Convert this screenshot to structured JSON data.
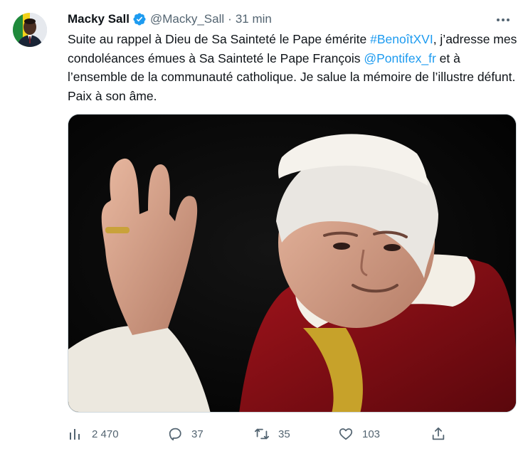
{
  "author": {
    "name": "Macky Sall",
    "handle": "@Macky_Sall",
    "separator": "·",
    "time": "31 min"
  },
  "tweet": {
    "part1": "Suite au rappel à Dieu de Sa Sainteté le Pape émérite ",
    "hashtag": "#BenoîtXVI",
    "part2": ", j’adresse mes condoléances émues à Sa Sainteté le Pape François ",
    "mention": "@Pontifex_fr",
    "part3": " et à l’ensemble de la communauté catholique. Je salue la mémoire de l’illustre défunt. Paix à son âme."
  },
  "actions": {
    "views": "2 470",
    "replies": "37",
    "retweets": "35",
    "likes": "103"
  },
  "colors": {
    "link": "#1d9bf0",
    "verified": "#1d9bf0",
    "muted": "#536471",
    "text": "#0f1419"
  },
  "icons": [
    "verified-badge-icon",
    "more-icon",
    "views-icon",
    "reply-icon",
    "retweet-icon",
    "like-icon",
    "share-icon"
  ]
}
